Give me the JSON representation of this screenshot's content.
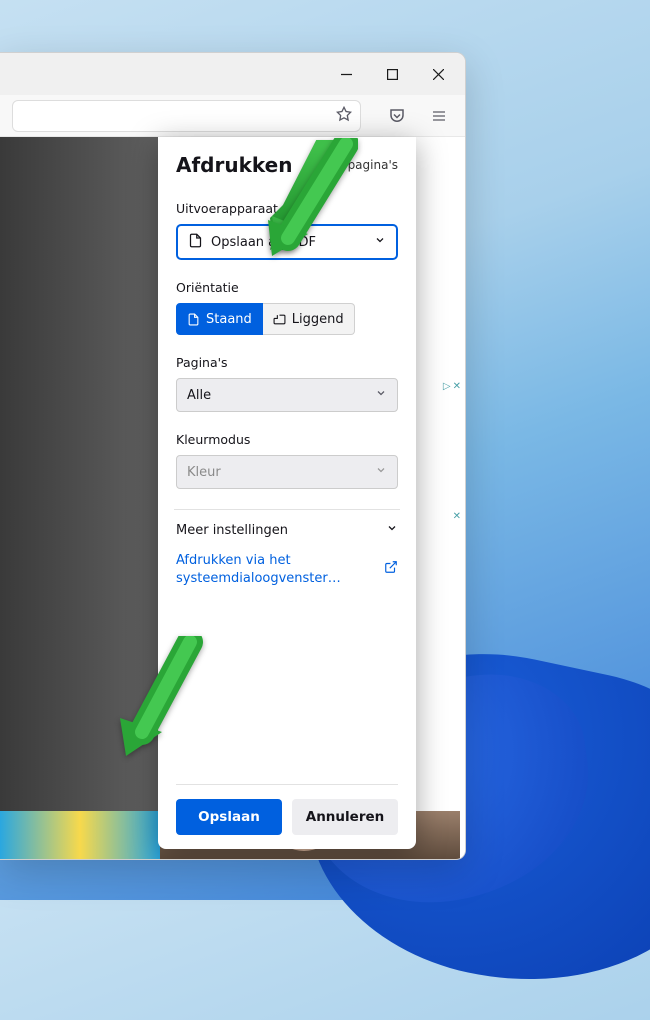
{
  "dialog": {
    "title": "Afdrukken",
    "page_count": "11 pagina's",
    "output_label": "Uitvoerapparaat",
    "output_value": "Opslaan als PDF",
    "orientation_label": "Oriëntatie",
    "orientation_portrait": "Staand",
    "orientation_landscape": "Liggend",
    "pages_label": "Pagina's",
    "pages_value": "Alle",
    "color_label": "Kleurmodus",
    "color_value": "Kleur",
    "more_settings": "Meer instellingen",
    "system_dialog_link": "Afdrukken via het systeemdialoogvenster…",
    "save_button": "Opslaan",
    "cancel_button": "Annuleren"
  },
  "colors": {
    "accent": "#0060df",
    "arrow": "#2aa637"
  }
}
